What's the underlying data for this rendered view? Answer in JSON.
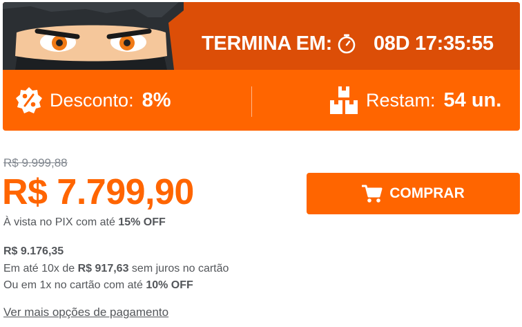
{
  "offer": {
    "countdown_label": "TERMINA EM:",
    "countdown_value": "08D 17:35:55",
    "discount_label": "Desconto:",
    "discount_value": "8%",
    "stock_label": "Restam:",
    "stock_value": "54 un.",
    "colors": {
      "banner_top": "#dc4e07",
      "banner": "#ff6500"
    },
    "icons": [
      "ninja-mascot",
      "stopwatch-icon",
      "percent-badge-icon",
      "boxes-icon"
    ]
  },
  "pricing": {
    "old_price": "R$ 9.999,88",
    "price": "R$ 7.799,90",
    "pix_text": "À vista no PIX com até ",
    "pix_discount": "15% OFF",
    "card_price": "R$ 9.176,35",
    "installments_prefix": "Em até 10x de ",
    "installment_value": "R$ 917,63",
    "installments_suffix": " sem juros no cartão",
    "onetime_text": "Ou em 1x no cartão com até ",
    "onetime_discount": "10% OFF",
    "more_options_link": "Ver mais opções de pagamento",
    "accent_color": "#ff6500"
  },
  "actions": {
    "buy_label": "COMPRAR",
    "buy_icon": "cart-icon"
  }
}
